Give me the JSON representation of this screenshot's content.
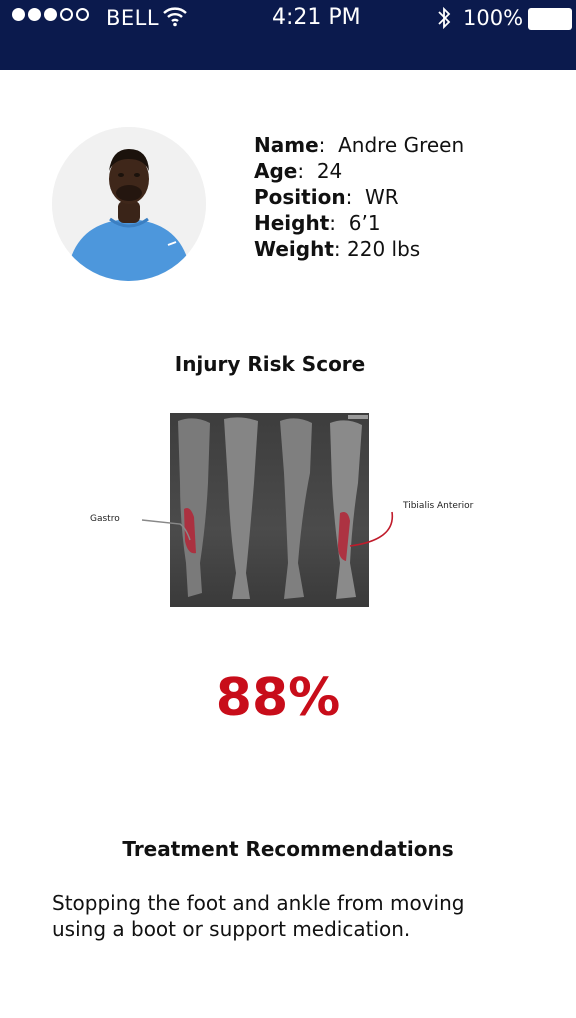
{
  "status_bar": {
    "carrier": "BELL",
    "time": "4:21 PM",
    "battery": "100%",
    "signal_bars_filled": 3,
    "signal_bars_total": 5,
    "background_color": "#0b1a4d"
  },
  "profile": {
    "name_label": "Name",
    "name_value": "Andre Green",
    "age_label": "Age",
    "age_value": "24",
    "position_label": "Position",
    "position_value": "WR",
    "height_label": "Height",
    "height_value": "6’1",
    "weight_label": "Weight",
    "weight_value": "220 lbs"
  },
  "injury_risk": {
    "title": "Injury Risk Score",
    "labels": {
      "left": "Gastro",
      "right": "Tibialis Anterior"
    },
    "score": "88%",
    "score_color": "#c80d1a"
  },
  "treatment": {
    "title": "Treatment Recommendations",
    "text": "Stopping the foot and ankle from moving using a boot or support medication."
  }
}
